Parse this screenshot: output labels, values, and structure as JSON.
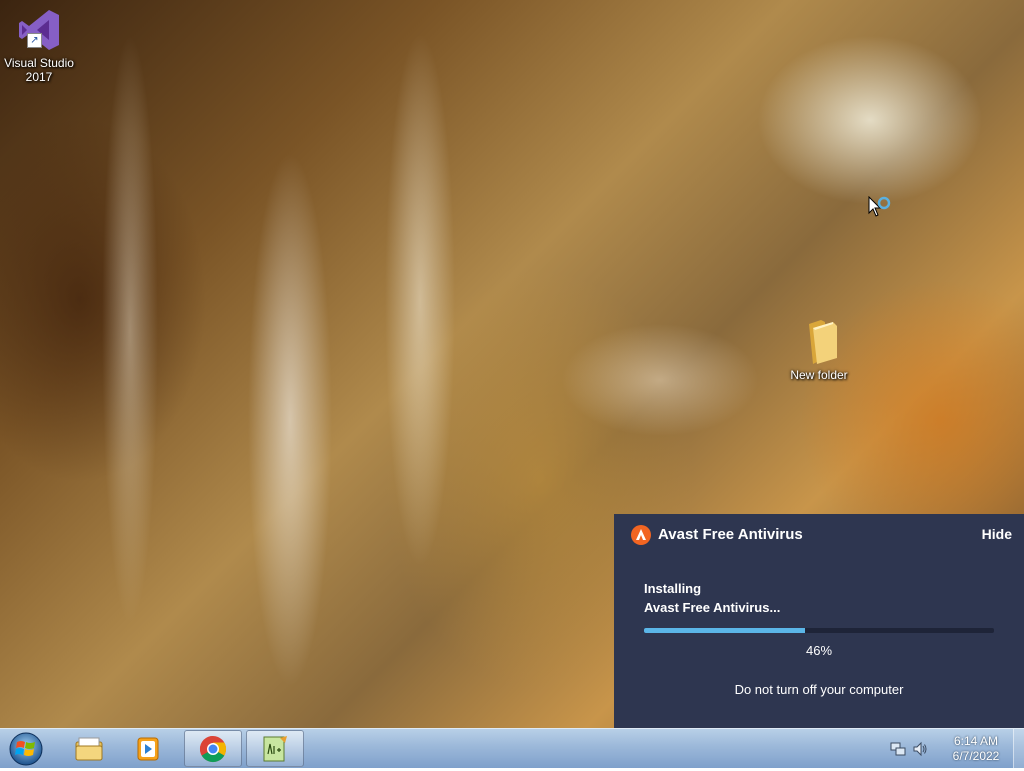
{
  "desktop": {
    "icons": [
      {
        "label": "Visual Studio\n2017",
        "icon": "visual-studio-icon"
      },
      {
        "label": "New folder",
        "icon": "folder-icon"
      }
    ]
  },
  "avast": {
    "title": "Avast Free Antivirus",
    "hide_label": "Hide",
    "status_line1": "Installing",
    "status_line2": "Avast Free Antivirus...",
    "progress": 0.46,
    "percent_label": "46%",
    "warning": "Do not turn off your computer",
    "colors": {
      "background": "#2e3650",
      "progress": "#5bb6e8",
      "logo": "#f26522"
    }
  },
  "taskbar": {
    "start_icon": "windows-logo-icon",
    "pinned": [
      {
        "name": "windows-explorer",
        "icon": "folder-library-icon"
      },
      {
        "name": "media-player",
        "icon": "media-player-icon"
      },
      {
        "name": "chrome",
        "icon": "chrome-icon",
        "active": true
      },
      {
        "name": "notepad-plus",
        "icon": "notepad-icon",
        "active": true
      }
    ],
    "clock": {
      "time": "6:14 AM",
      "date": "6/7/2022"
    }
  }
}
